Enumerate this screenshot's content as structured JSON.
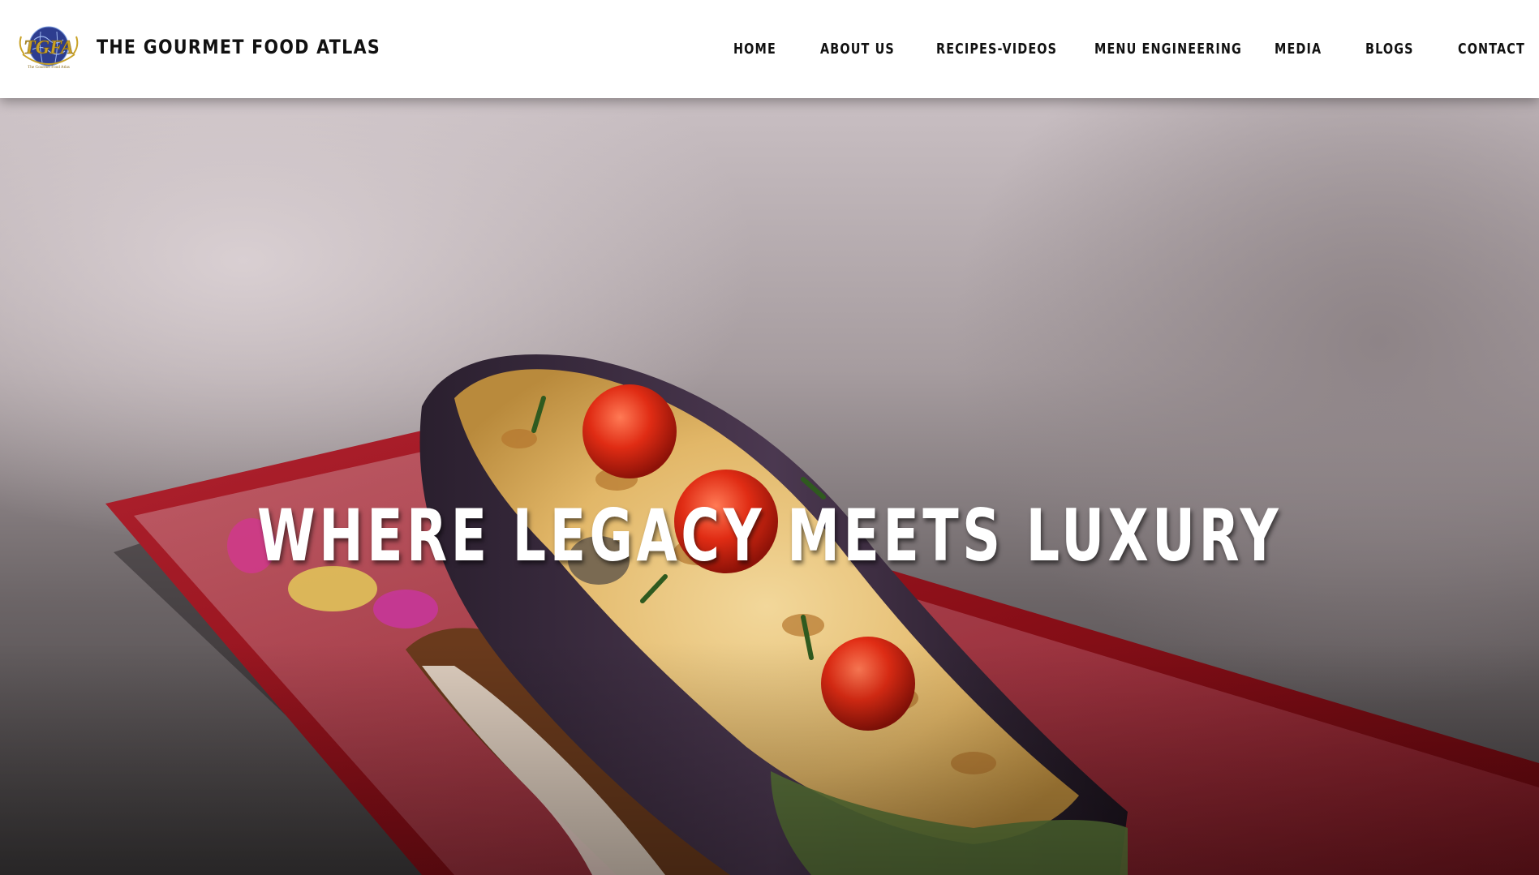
{
  "header": {
    "logo": {
      "icon": "globe-emblem-icon",
      "monogram": "TGFA",
      "tagline": "The Gourmet Food Atlas"
    },
    "site_title": "THE GOURMET FOOD ATLAS",
    "nav": [
      {
        "label": "HOME"
      },
      {
        "label": "ABOUT US"
      },
      {
        "label": "RECIPES-VIDEOS"
      },
      {
        "label": "MENU ENGINEERING"
      },
      {
        "label": "MEDIA"
      },
      {
        "label": "BLOGS"
      },
      {
        "label": "CONTACT"
      }
    ]
  },
  "hero": {
    "heading": "WHERE LEGACY MEETS LUXURY",
    "image": "stuffed-eggplant-photo"
  },
  "colors": {
    "header_bg": "#ffffff",
    "text_dark": "#111111",
    "logo_gold": "#c9a227",
    "logo_blue": "#2d3d8f",
    "plate_red": "#8b0f18",
    "heading_white": "#ffffff"
  }
}
